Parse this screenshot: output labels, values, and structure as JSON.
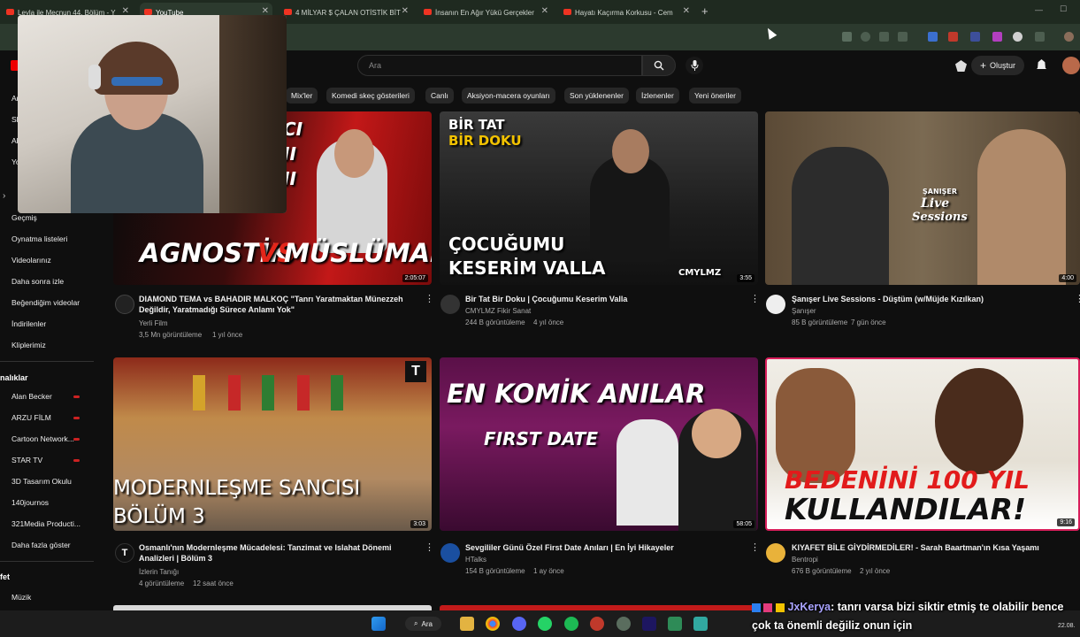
{
  "browser": {
    "tabs": [
      {
        "label": "Leyla ile Mecnun 44. Bölüm - Y",
        "active": false
      },
      {
        "label": "YouTube",
        "active": true
      },
      {
        "label": "4 MİLYAR $ ÇALAN OTİSTİK BİT",
        "active": false
      },
      {
        "label": "İnsanın En Ağır Yükü Gerçekler",
        "active": false
      },
      {
        "label": "Hayatı Kaçırma Korkusu - Cem",
        "active": false
      }
    ],
    "new_tab": "+"
  },
  "header": {
    "search_placeholder": "Ara",
    "create_label": "Oluştur"
  },
  "chips": [
    "Mix'ler",
    "Komedi skeç gösterileri",
    "Canlı",
    "Aksiyon-macera oyunları",
    "Son yüklenenler",
    "İzlenenler",
    "Yeni öneriler"
  ],
  "sidebar": {
    "partial_top": [
      "An",
      "Sh",
      "Ab",
      "Yo"
    ],
    "you_items": [
      "Geçmiş",
      "Oynatma listeleri",
      "Videolarınız",
      "Daha sonra izle",
      "Beğendiğim videolar",
      "İndirilenler",
      "Kliplerimiz"
    ],
    "subs_heading": "nalıklar",
    "subs": [
      "Alan Becker",
      "ARZU FİLM",
      "Cartoon Network...",
      "STAR TV",
      "3D Tasarım Okulu",
      "140journos",
      "321Media Producti...",
      "Daha fazla göster"
    ],
    "explore_heading": "fet",
    "explore_items": [
      "Müzik"
    ]
  },
  "videos": [
    {
      "title": "DIAMOND TEMA vs BAHADIR MALKOÇ \"Tanrı Yaratmaktan Münezzeh Değildir, Yaratmadığı Sürece Anlamı Yok\"",
      "channel": "Yerli Film",
      "views": "3,5 Mn görüntüleme",
      "age": "1 yıl önce",
      "duration": "2:05:07",
      "thumb_text": [
        "AGNOSTİK",
        "VS",
        "MÜSLÜMAN"
      ],
      "thumb_top_text": [
        "CI",
        "II",
        "II"
      ]
    },
    {
      "title": "Bir Tat Bir Doku | Çocuğumu Keserim Valla",
      "channel": "CMYLMZ Fikir Sanat",
      "views": "244 B görüntüleme",
      "age": "4 yıl önce",
      "duration": "3:55",
      "thumb_text": [
        "BİR TAT",
        "BİR DOKU",
        "ÇOCUĞUMU",
        "KESERİM VALLA",
        "CMYLMZ"
      ]
    },
    {
      "title": "Şanışer Live Sessions - Düştüm (w/Müjde Kızılkan)",
      "channel": "Şanışer",
      "views": "85 B görüntüleme",
      "age": "7 gün önce",
      "duration": "4:00",
      "thumb_text": [
        "ŞANIŞER",
        "Live",
        "Sessions"
      ]
    },
    {
      "title": "Osmanlı'nın Modernleşme Mücadelesi: Tanzimat ve Islahat Dönemi Analizleri | Bölüm 3",
      "channel": "İzlerin Tanığı",
      "views": "4 görüntüleme",
      "age": "12 saat önce",
      "duration": "3:03",
      "thumb_text": [
        "MODERNLEŞME SANCISI",
        "BÖLÜM 3"
      ]
    },
    {
      "title": "Sevgililer Günü Özel First Date Anıları | En İyi Hikayeler",
      "channel": "HTalks",
      "views": "154 B görüntüleme",
      "age": "1 ay önce",
      "duration": "58:05",
      "thumb_text": [
        "EN KOMİK ANILAR",
        "FIRST DATE"
      ]
    },
    {
      "title": "KIYAFET BİLE GİYDİRMEDİLER! - Sarah Baartman'ın Kısa Yaşamı",
      "channel": "Bentropi",
      "views": "676 B görüntüleme",
      "age": "2 yıl önce",
      "duration": "9:16",
      "thumb_text": [
        "BEDENİNİ 100 YIL",
        "KULLANDILAR!"
      ]
    }
  ],
  "taskbar": {
    "search_label": "Ara",
    "clock": "22.08."
  },
  "chat": {
    "user": "JxKerya",
    "message": ": tanrı varsa bizi siktir etmiş te olabilir bence çok ta önemli değiliz onun için"
  },
  "colors": {
    "bg": "#0f0f0f",
    "chip": "#272727",
    "accent": "#ff0000"
  }
}
